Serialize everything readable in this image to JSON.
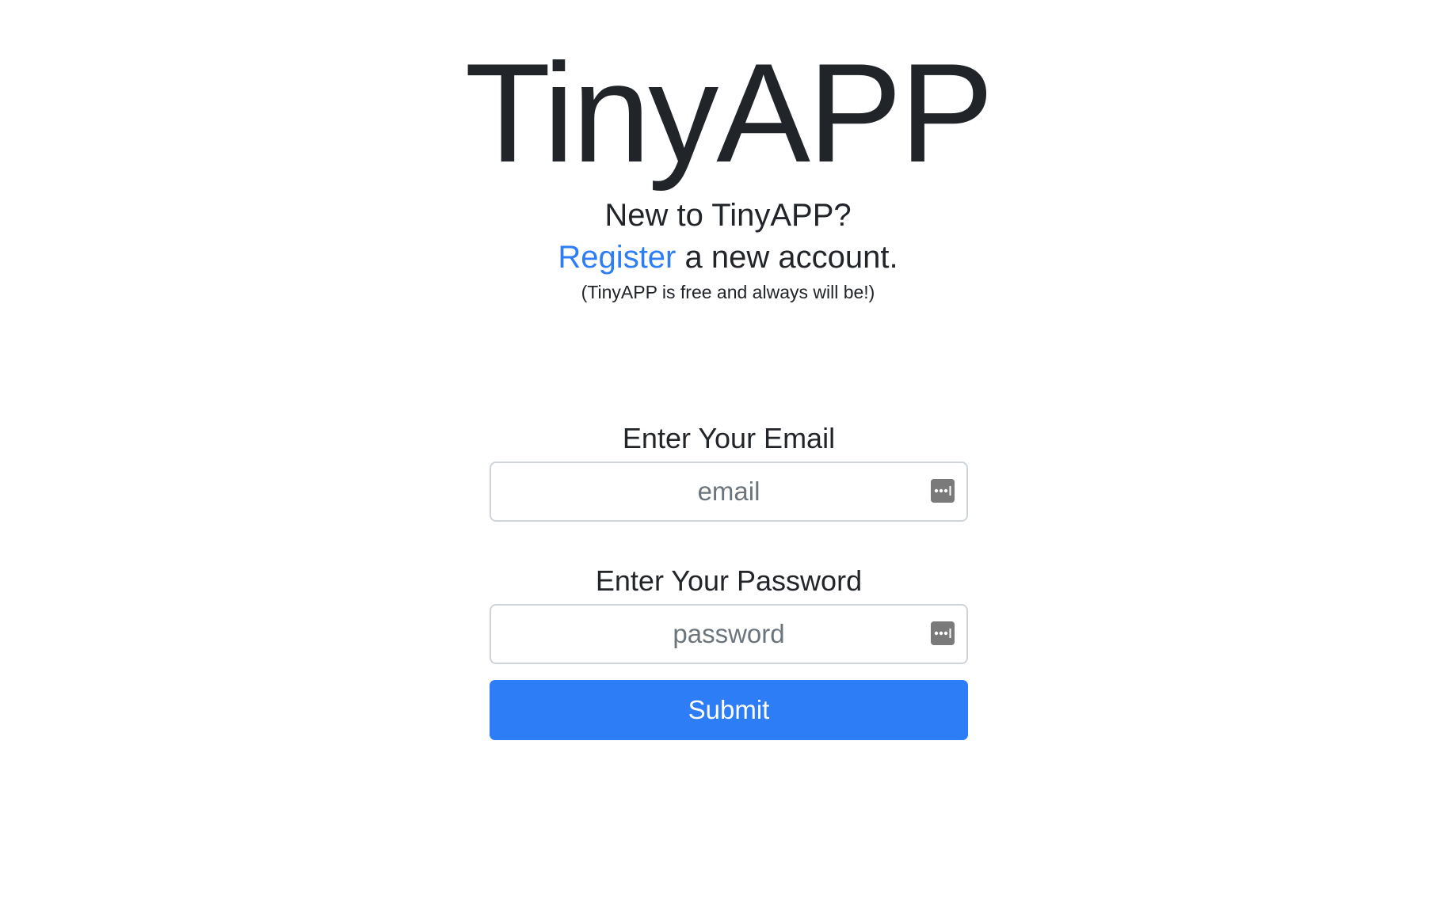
{
  "header": {
    "title": "TinyAPP"
  },
  "intro": {
    "question": "New to TinyAPP?",
    "register_link": "Register",
    "register_suffix": " a new account.",
    "note": "(TinyAPP is free and always will be!)"
  },
  "login_form": {
    "email": {
      "label": "Enter Your Email",
      "placeholder": "email",
      "value": ""
    },
    "password": {
      "label": "Enter Your Password",
      "placeholder": "password",
      "value": ""
    },
    "submit_label": "Submit",
    "autofill_icon": "password-manager-key-icon"
  },
  "colors": {
    "accent": "#2c7df6",
    "text": "#212529",
    "placeholder": "#6c757d",
    "input_border": "#ced4da"
  }
}
